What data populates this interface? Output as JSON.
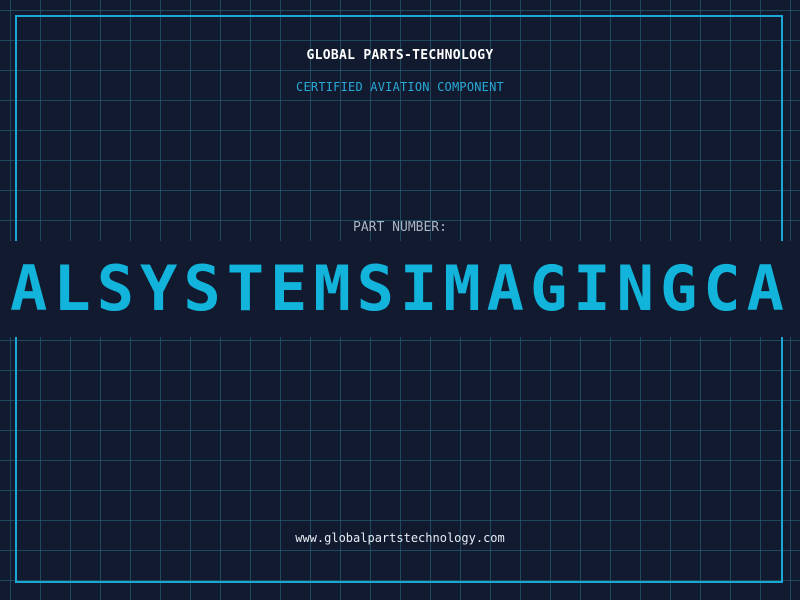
{
  "header": {
    "company": "GLOBAL PARTS-TECHNOLOGY",
    "subtitle": "CERTIFIED AVIATION COMPONENT"
  },
  "part": {
    "label": "PART NUMBER:",
    "value": "ALSYSTEMSIMAGINGCA"
  },
  "footer": {
    "website": "www.globalpartstechnology.com"
  },
  "colors": {
    "background": "#111a2e",
    "grid": "#286e82",
    "frame": "#1aa8d6",
    "accent": "#12b4dc"
  }
}
